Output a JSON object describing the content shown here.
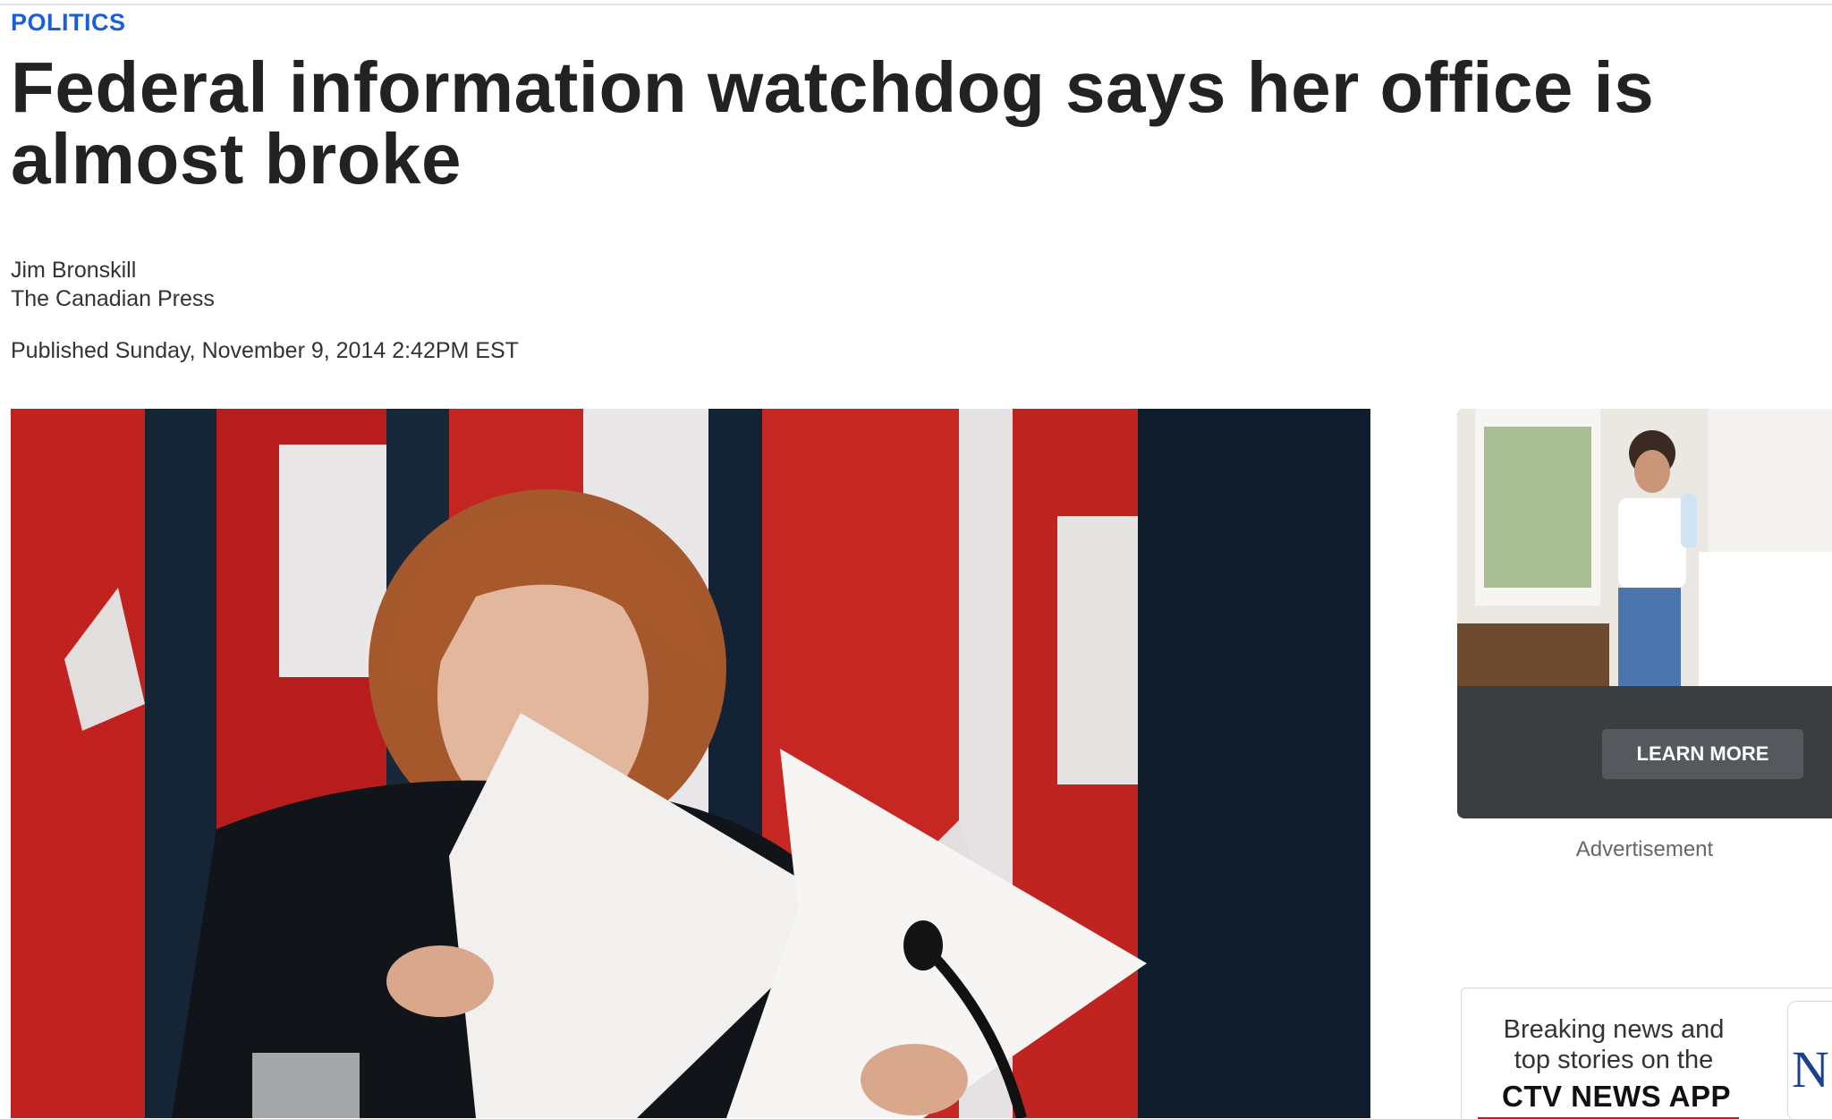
{
  "section": {
    "label": "POLITICS"
  },
  "article": {
    "headline": "Federal information watchdog says her office is almost broke",
    "author": "Jim Bronskill",
    "source": "The Canadian Press",
    "published": "Published Sunday, November 9, 2014 2:42PM EST"
  },
  "ad": {
    "button_label": "LEARN MORE",
    "label": "Advertisement"
  },
  "promo": {
    "line1": "Breaking news and",
    "line2": "top stories on the",
    "app_name": "CTV NEWS APP",
    "thumb_letter": "N"
  },
  "colors": {
    "section_link": "#1a5fd8",
    "ad_panel": "#3b3d40",
    "promo_accent": "#d0141e"
  }
}
